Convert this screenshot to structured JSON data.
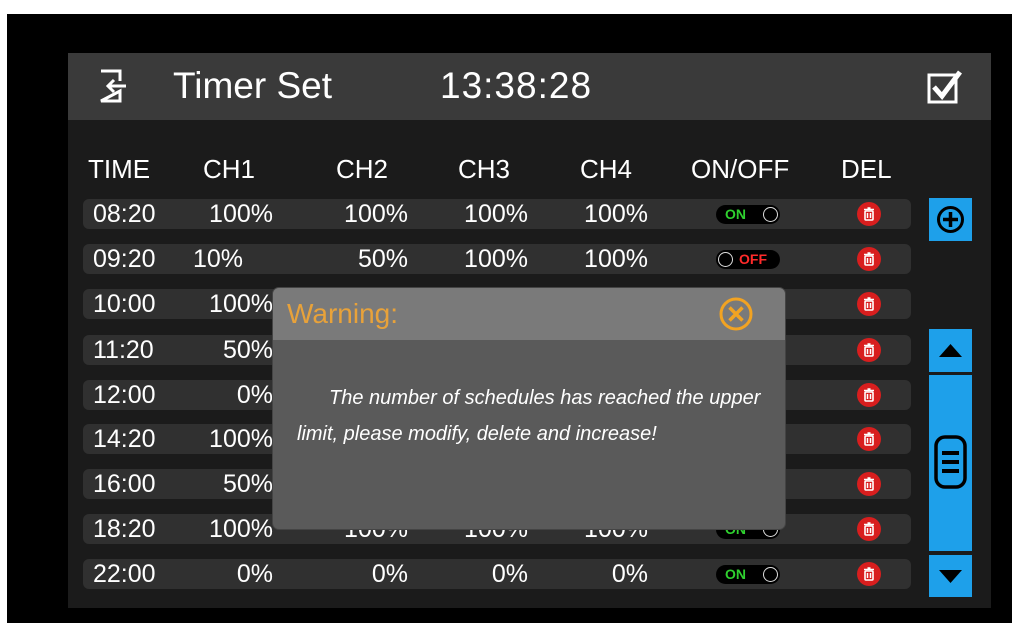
{
  "header": {
    "title": "Timer Set",
    "time": "13:38:28"
  },
  "columns": [
    "TIME",
    "CH1",
    "CH2",
    "CH3",
    "CH4",
    "ON/OFF",
    "DEL"
  ],
  "rows": [
    {
      "time": "08:20",
      "ch1": "100%",
      "ch2": "100%",
      "ch3": "100%",
      "ch4": "100%",
      "state": "ON"
    },
    {
      "time": "09:20",
      "ch1": "10%",
      "ch2": "50%",
      "ch3": "100%",
      "ch4": "100%",
      "state": "OFF"
    },
    {
      "time": "10:00",
      "ch1": "100%",
      "ch2": "",
      "ch3": "",
      "ch4": "",
      "state": ""
    },
    {
      "time": "11:20",
      "ch1": "50%",
      "ch2": "",
      "ch3": "",
      "ch4": "",
      "state": ""
    },
    {
      "time": "12:00",
      "ch1": "0%",
      "ch2": "",
      "ch3": "",
      "ch4": "",
      "state": ""
    },
    {
      "time": "14:20",
      "ch1": "100%",
      "ch2": "",
      "ch3": "",
      "ch4": "",
      "state": ""
    },
    {
      "time": "16:00",
      "ch1": "50%",
      "ch2": "",
      "ch3": "",
      "ch4": "",
      "state": ""
    },
    {
      "time": "18:20",
      "ch1": "100%",
      "ch2": "100%",
      "ch3": "100%",
      "ch4": "100%",
      "state": "ON"
    },
    {
      "time": "22:00",
      "ch1": "0%",
      "ch2": "0%",
      "ch3": "0%",
      "ch4": "0%",
      "state": "ON"
    }
  ],
  "dialog": {
    "title": "Warning:",
    "message": "The number of schedules has reached the upper limit, please modify, delete and increase!"
  },
  "colors": {
    "accent": "#1ea0ea",
    "warning": "#e8a23a",
    "on": "#2fd12f",
    "off": "#ff2a2a",
    "delete": "#d81e1e"
  },
  "icons": [
    "exit-icon",
    "checkbox-checked-icon",
    "add-circle-icon",
    "triangle-up-icon",
    "triangle-down-icon",
    "scroll-handle-icon",
    "trash-icon",
    "close-circle-icon"
  ]
}
